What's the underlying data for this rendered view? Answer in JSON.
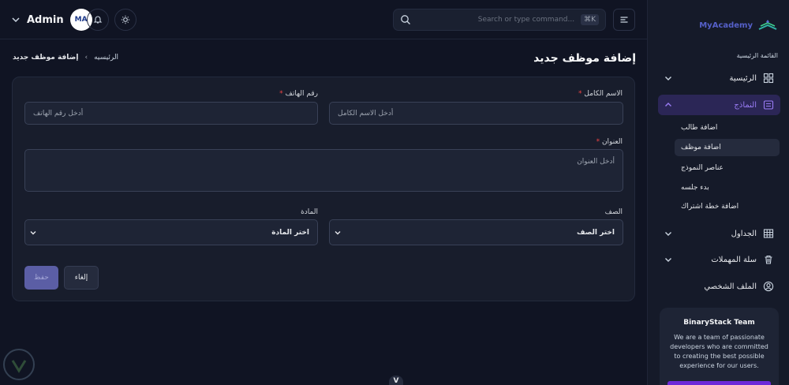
{
  "header": {
    "user_name": "Admin",
    "avatar_text": "MA",
    "search_placeholder": "Search or type command...",
    "search_shortcut": "⌘K"
  },
  "page": {
    "title": "إضافة موظف جديد",
    "breadcrumb": {
      "home": "الرئيسيه",
      "current": "إضافة موظف جديد"
    }
  },
  "form": {
    "full_name": {
      "label": "الاسم الكامل",
      "placeholder": "أدخل الاسم الكامل"
    },
    "phone": {
      "label": "رقم الهاتف",
      "placeholder": "أدخل رقم الهاتف"
    },
    "address": {
      "label": "العنوان",
      "placeholder": "أدخل العنوان"
    },
    "class": {
      "label": "الصف",
      "selected": "اختر الصف"
    },
    "subject": {
      "label": "المادة",
      "selected": "اختر المادة"
    },
    "required_mark": "*",
    "cancel_label": "إلغاء",
    "save_label": "حفظ"
  },
  "sidebar": {
    "brand": "MyAcademy",
    "section_title": "القائمة الرئيسية",
    "items": [
      {
        "label": "الرئيسية",
        "icon": "grid-icon"
      },
      {
        "label": "النماذج",
        "icon": "form-icon"
      },
      {
        "label": "الجداول",
        "icon": "table-icon"
      },
      {
        "label": "سلة المهملات",
        "icon": "trash-icon"
      },
      {
        "label": "الملف الشخصي",
        "icon": "user-circle-icon"
      }
    ],
    "sub_items": [
      {
        "label": "اضافة طالب"
      },
      {
        "label": "اضافة موظف"
      },
      {
        "label": "عناصر النموذج"
      },
      {
        "label": "بدء جلسه"
      },
      {
        "label": "اضافة خطة اشتراك"
      }
    ],
    "promo": {
      "title": "BinaryStack Team",
      "body": "We are a team of passionate developers who are committed to creating the best possible experience for our users."
    }
  },
  "footer": {
    "handle_letter": "V"
  },
  "colors": {
    "accent": "#9a7cf5",
    "brand": "#5560c9",
    "required": "#ef4444",
    "background": "#101423"
  }
}
